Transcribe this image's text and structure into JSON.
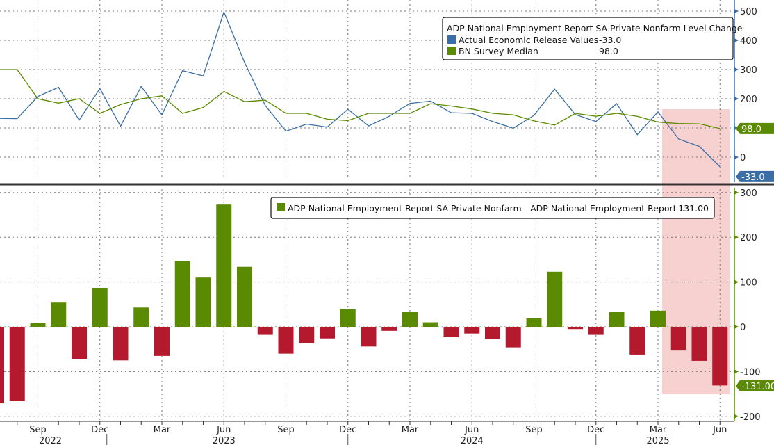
{
  "chart_data": [
    {
      "type": "line",
      "title": "ADP National Employment Report SA Private Nonfarm Level Change",
      "x": [
        "2022-07",
        "2022-08",
        "2022-09",
        "2022-10",
        "2022-11",
        "2022-12",
        "2023-01",
        "2023-02",
        "2023-03",
        "2023-04",
        "2023-05",
        "2023-06",
        "2023-07",
        "2023-08",
        "2023-09",
        "2023-10",
        "2023-11",
        "2023-12",
        "2024-01",
        "2024-02",
        "2024-03",
        "2024-04",
        "2024-05",
        "2024-06",
        "2024-07",
        "2024-08",
        "2024-09",
        "2024-10",
        "2024-11",
        "2024-12",
        "2025-01",
        "2025-02",
        "2025-03",
        "2025-04",
        "2025-05",
        "2025-06"
      ],
      "series": [
        {
          "name": "Actual Economic Release Values",
          "legend_value": "-33.0",
          "last_label": "-33.0",
          "color": "#3a6ea5",
          "values": [
            133,
            132,
            208,
            239,
            127,
            235,
            106,
            242,
            145,
            296,
            278,
            497,
            324,
            177,
            89,
            113,
            103,
            164,
            107,
            140,
            184,
            192,
            152,
            150,
            122,
            99,
            143,
            233,
            146,
            122,
            183,
            77,
            155,
            62,
            37,
            -33
          ]
        },
        {
          "name": "BN Survey Median",
          "legend_value": "98.0",
          "last_label": "98.0",
          "color": "#5a8a00",
          "values": [
            300,
            300,
            200,
            185,
            200,
            150,
            180,
            200,
            210,
            150,
            170,
            225,
            190,
            195,
            150,
            150,
            130,
            125,
            150,
            150,
            150,
            183,
            175,
            165,
            150,
            145,
            124,
            110,
            150,
            140,
            150,
            140,
            120,
            115,
            114,
            98
          ]
        }
      ],
      "y_ticks": [
        "500",
        "400",
        "300",
        "200",
        "100",
        "0"
      ],
      "ylim": [
        -50,
        520
      ],
      "grid": true,
      "legend_placement": "top-right"
    },
    {
      "type": "bar",
      "legend": "ADP National Employment Report SA Private Nonfarm - ADP National Employment Report ...",
      "legend_value": "-131.00",
      "last_label": "-131.00",
      "x": [
        "2022-07",
        "2022-08",
        "2022-09",
        "2022-10",
        "2022-11",
        "2022-12",
        "2023-01",
        "2023-02",
        "2023-03",
        "2023-04",
        "2023-05",
        "2023-06",
        "2023-07",
        "2023-08",
        "2023-09",
        "2023-10",
        "2023-11",
        "2023-12",
        "2024-01",
        "2024-02",
        "2024-03",
        "2024-04",
        "2024-05",
        "2024-06",
        "2024-07",
        "2024-08",
        "2024-09",
        "2024-10",
        "2024-11",
        "2024-12",
        "2025-01",
        "2025-02",
        "2025-03",
        "2025-04",
        "2025-05",
        "2025-06"
      ],
      "values": [
        -171,
        -166,
        8,
        54,
        -72,
        87,
        -75,
        43,
        -65,
        147,
        110,
        273,
        134,
        -18,
        -60,
        -37,
        -26,
        40,
        -44,
        -9,
        34,
        10,
        -23,
        -15,
        -28,
        -46,
        19,
        123,
        -5,
        -18,
        33,
        -62,
        36,
        -53,
        -76,
        -131
      ],
      "positive_color": "#5a8a00",
      "negative_color": "#b5192e",
      "y_ticks": [
        "300",
        "200",
        "100",
        "0",
        "-100",
        "-200"
      ],
      "ylim": [
        -210,
        310
      ],
      "grid": true,
      "legend_placement": "top-right"
    }
  ],
  "x_axis": {
    "month_labels": [
      {
        "label": "Sep",
        "month": "2022-09"
      },
      {
        "label": "Dec",
        "month": "2022-12"
      },
      {
        "label": "Mar",
        "month": "2023-03"
      },
      {
        "label": "Jun",
        "month": "2023-06"
      },
      {
        "label": "Sep",
        "month": "2023-09"
      },
      {
        "label": "Dec",
        "month": "2023-12"
      },
      {
        "label": "Mar",
        "month": "2024-03"
      },
      {
        "label": "Jun",
        "month": "2024-06"
      },
      {
        "label": "Sep",
        "month": "2024-09"
      },
      {
        "label": "Dec",
        "month": "2024-12"
      },
      {
        "label": "Mar",
        "month": "2025-03"
      },
      {
        "label": "Jun",
        "month": "2025-06"
      }
    ],
    "year_labels": [
      {
        "label": "2022",
        "month": "2022-09"
      },
      {
        "label": "2023",
        "month": "2023-06"
      },
      {
        "label": "2024",
        "month": "2024-06"
      },
      {
        "label": "2025",
        "month": "2025-03"
      }
    ]
  },
  "highlight": {
    "from": "2025-03",
    "to": "2025-06",
    "color": "#f7d0d0"
  }
}
